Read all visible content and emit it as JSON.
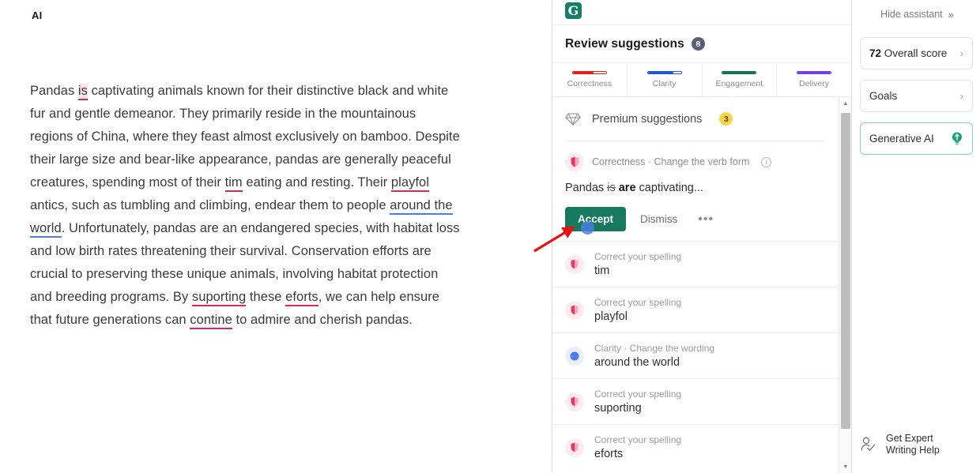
{
  "document": {
    "title": "AI",
    "paragraph_parts": [
      {
        "t": "Pandas ",
        "style": "plain"
      },
      {
        "t": "is",
        "style": "err-red-hl"
      },
      {
        "t": " captivating animals known for their distinctive black and white fur and gentle demeanor. They primarily reside in the mountainous regions of China, where they feast almost exclusively on bamboo. Despite their large size and bear-like appearance, pandas are generally peaceful creatures, spending most of their ",
        "style": "plain"
      },
      {
        "t": "tim",
        "style": "err-red"
      },
      {
        "t": " eating and resting. Their ",
        "style": "plain"
      },
      {
        "t": "playfol",
        "style": "err-red"
      },
      {
        "t": " antics, such as tumbling and climbing, endear them to people ",
        "style": "plain"
      },
      {
        "t": "around the world",
        "style": "err-blue"
      },
      {
        "t": ". Unfortunately, pandas are an endangered species, with habitat loss and low birth rates threatening their survival. Conservation efforts are crucial to preserving these unique animals, involving habitat protection and breeding programs. By ",
        "style": "plain"
      },
      {
        "t": "suporting",
        "style": "err-red"
      },
      {
        "t": " these ",
        "style": "plain"
      },
      {
        "t": "eforts",
        "style": "err-red"
      },
      {
        "t": ", we can help ensure that future generations can ",
        "style": "plain"
      },
      {
        "t": "contine",
        "style": "err-red"
      },
      {
        "t": " to admire and cherish pandas.",
        "style": "plain"
      }
    ]
  },
  "panel": {
    "logo_letter": "G",
    "title": "Review suggestions",
    "title_count": "8",
    "tabs": [
      {
        "label": "Correctness",
        "color": "#e01f1f",
        "fill_pct": 62
      },
      {
        "label": "Clarity",
        "color": "#1f56d6",
        "fill_pct": 78
      },
      {
        "label": "Engagement",
        "color": "#11734f",
        "fill_pct": 100
      },
      {
        "label": "Delivery",
        "color": "#7140e0",
        "fill_pct": 100
      }
    ],
    "premium": {
      "icon": "diamond-icon",
      "label": "Premium suggestions",
      "count": "3",
      "badge_color": "#ffd24a"
    },
    "active_card": {
      "category": "Correctness · Change the verb form",
      "info_icon": "info-icon",
      "text_before": "Pandas ",
      "text_strike": "is",
      "text_replacement": "are",
      "text_after": " captivating...",
      "accept_label": "Accept",
      "dismiss_label": "Dismiss",
      "more_label": "•••",
      "accept_color": "#17795e"
    },
    "suggestions": [
      {
        "category": "Correct your spelling",
        "word": "tim",
        "type": "correctness"
      },
      {
        "category": "Correct your spelling",
        "word": "playfol",
        "type": "correctness"
      },
      {
        "category": "Clarity · Change the wording",
        "word": "around the world",
        "type": "clarity"
      },
      {
        "category": "Correct your spelling",
        "word": "suporting",
        "type": "correctness"
      },
      {
        "category": "Correct your spelling",
        "word": "eforts",
        "type": "correctness"
      }
    ],
    "scrollbar": {
      "up_arrow": "▲",
      "down_arrow": "▼"
    }
  },
  "rail": {
    "hide_label": "Hide assistant",
    "hide_chevron": "»",
    "cards": [
      {
        "score": "72",
        "label": "Overall score",
        "chevron": "›",
        "active": false
      },
      {
        "score": "",
        "label": "Goals",
        "chevron": "›",
        "active": false
      },
      {
        "score": "",
        "label": "Generative AI",
        "chevron": "",
        "active": true,
        "icon": "lightbulb-icon"
      }
    ],
    "expert": {
      "icon": "person-check-icon",
      "line1": "Get Expert",
      "line2": "Writing Help"
    }
  }
}
